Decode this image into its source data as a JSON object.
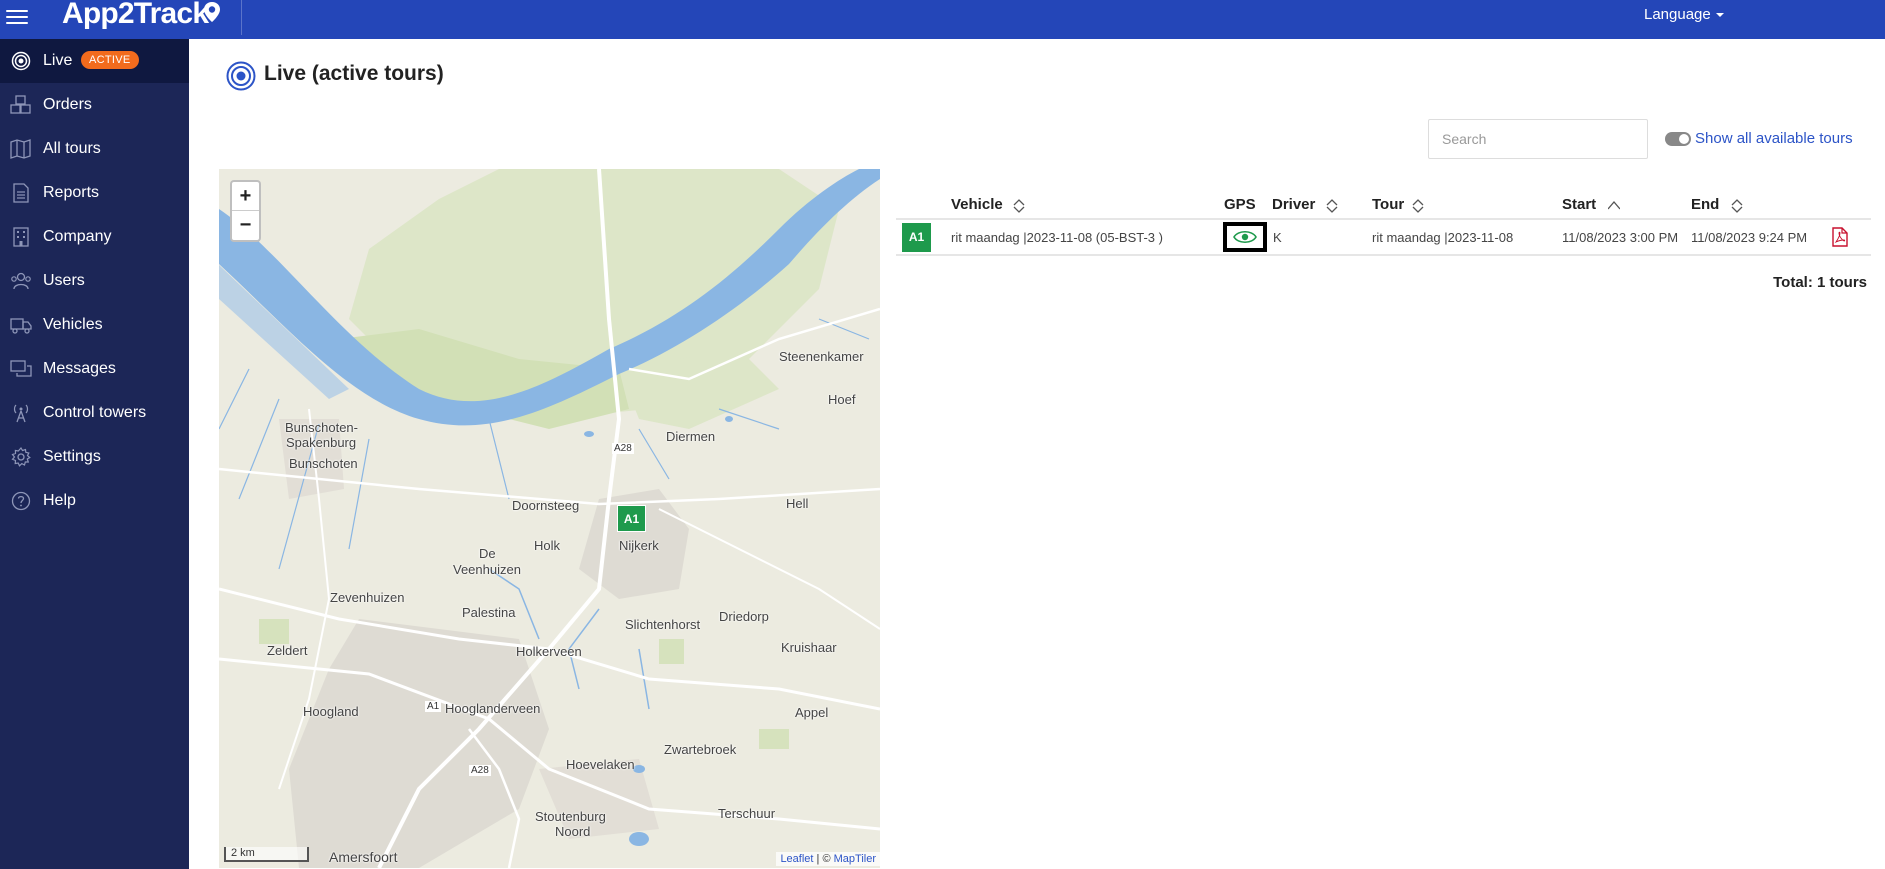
{
  "header": {
    "brand": "App2Track",
    "language_label": "Language"
  },
  "sidebar": {
    "items": [
      {
        "label": "Live",
        "icon": "target-icon",
        "badge": "ACTIVE",
        "active": true
      },
      {
        "label": "Orders",
        "icon": "boxes-icon"
      },
      {
        "label": "All tours",
        "icon": "map-route-icon"
      },
      {
        "label": "Reports",
        "icon": "document-icon"
      },
      {
        "label": "Company",
        "icon": "building-icon"
      },
      {
        "label": "Users",
        "icon": "users-icon"
      },
      {
        "label": "Vehicles",
        "icon": "truck-icon"
      },
      {
        "label": "Messages",
        "icon": "messages-icon"
      },
      {
        "label": "Control towers",
        "icon": "antenna-icon"
      },
      {
        "label": "Settings",
        "icon": "gear-icon"
      },
      {
        "label": "Help",
        "icon": "help-icon"
      }
    ]
  },
  "main": {
    "title": "Live (active tours)",
    "search_placeholder": "Search",
    "show_all_label": "Show all available tours",
    "show_all_enabled": true
  },
  "map": {
    "zoom_in": "+",
    "zoom_out": "−",
    "scale": "2 km",
    "attribution_leaflet": "Leaflet",
    "attribution_sep": " | © ",
    "attribution_maptiler": "MapTiler",
    "marker": "A1",
    "places": [
      "Steenenkamer",
      "Hoef",
      "Diermen",
      "Bunschoten-",
      "Spakenburg",
      "Bunschoten",
      "Doornsteeg",
      "Hell",
      "Holk",
      "Nijkerk",
      "De",
      "Veenhuizen",
      "Zevenhuizen",
      "Palestina",
      "Driedorp",
      "Slichtenhorst",
      "Kruishaar",
      "Zeldert",
      "Holkerveen",
      "Hoogland",
      "Hooglanderveen",
      "Appel",
      "Zwartebroek",
      "Hoevelaken",
      "Terschuur",
      "Stoutenburg",
      "Noord",
      "Amersfoort"
    ],
    "roads": [
      "A28",
      "A1",
      "A28"
    ]
  },
  "table": {
    "columns": [
      "Vehicle",
      "GPS",
      "Driver",
      "Tour",
      "Start",
      "End"
    ],
    "rows": [
      {
        "badge": "A1",
        "vehicle": "rit maandag |2023-11-08 (05-BST-3 )",
        "driver": "K",
        "tour": "rit maandag |2023-11-08",
        "start": "11/08/2023 3:00 PM",
        "end": "11/08/2023 9:24 PM"
      }
    ],
    "total": "Total: 1 tours"
  },
  "colors": {
    "topbar": "#2446b8",
    "sidebar": "#1c2657",
    "badge": "#f26b1d",
    "vehicle_green": "#1e9a4c",
    "link_blue": "#2c54c7"
  }
}
